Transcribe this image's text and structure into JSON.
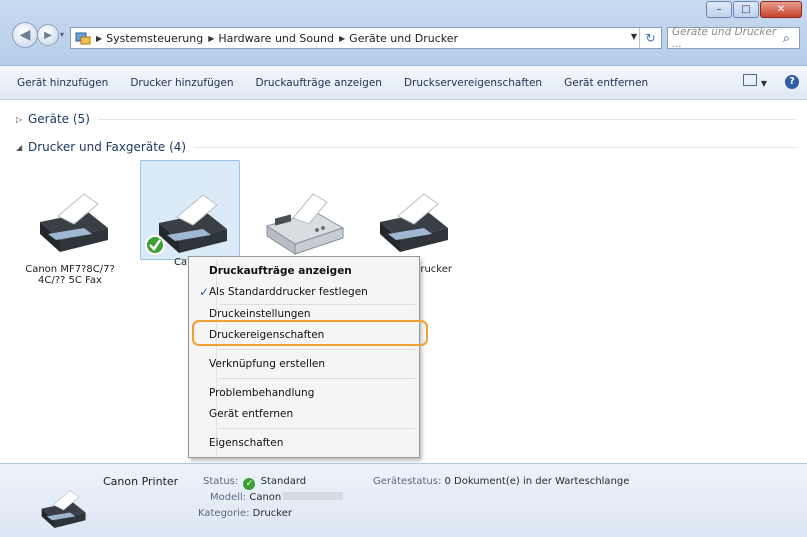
{
  "window": {
    "controls": [
      "–",
      "□",
      "✕"
    ]
  },
  "address_bar": {
    "crumbs": [
      "Systemsteuerung",
      "Hardware und Sound",
      "Geräte und Drucker"
    ]
  },
  "search": {
    "placeholder": "Geräte und Drucker ..."
  },
  "toolbar": {
    "buttons": [
      "Gerät hinzufügen",
      "Drucker hinzufügen",
      "Druckaufträge anzeigen",
      "Druckservereigenschaften",
      "Gerät entfernen"
    ]
  },
  "groups": {
    "devices": "Geräte (5)",
    "printers": "Drucker und Faxgeräte (4)"
  },
  "devices": [
    {
      "label": "Canon MF7?8C/7?4C/?? 5C Fax"
    },
    {
      "label": "Canon"
    },
    {
      "label": ""
    },
    {
      "label": "XPS Drucker"
    }
  ],
  "context_menu": {
    "items": [
      "Druckaufträge anzeigen",
      "Als Standarddrucker festlegen",
      "Druckeinstellungen",
      "Druckereigenschaften",
      "Verknüpfung erstellen",
      "Problembehandlung",
      "Gerät entfernen",
      "Eigenschaften"
    ],
    "checked_item": "Als Standarddrucker festlegen",
    "highlighted_item": "Druckereigenschaften"
  },
  "details": {
    "name": "Canon Printer",
    "status_label": "Status:",
    "status_value": "Standard",
    "model_label": "Modell:",
    "model_value": "Canon",
    "category_label": "Kategorie:",
    "category_value": "Drucker",
    "device_status_label": "Gerätestatus:",
    "device_status_value": "0 Dokument(e) in der Warteschlange"
  },
  "colors": {
    "highlight_ring": "#f0a030",
    "status_green": "#3aa034"
  }
}
